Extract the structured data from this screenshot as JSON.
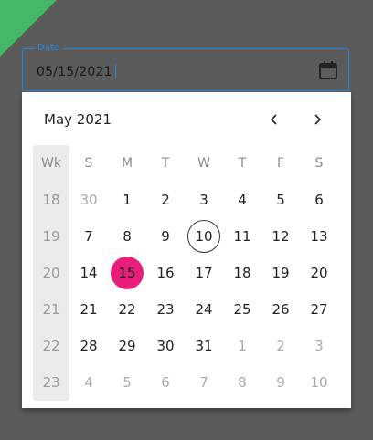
{
  "field": {
    "label": "Date",
    "value": "05/15/2021"
  },
  "calendar": {
    "month_title": "May 2021",
    "prev_symbol": "‹",
    "next_symbol": "›",
    "week_header": "Wk",
    "day_headers": [
      "S",
      "M",
      "T",
      "W",
      "T",
      "F",
      "S"
    ],
    "weeks": [
      {
        "wk": "18",
        "days": [
          {
            "d": "30",
            "muted": true
          },
          {
            "d": "1"
          },
          {
            "d": "2"
          },
          {
            "d": "3"
          },
          {
            "d": "4"
          },
          {
            "d": "5"
          },
          {
            "d": "6"
          }
        ]
      },
      {
        "wk": "19",
        "days": [
          {
            "d": "7"
          },
          {
            "d": "8"
          },
          {
            "d": "9"
          },
          {
            "d": "10",
            "today": true
          },
          {
            "d": "11"
          },
          {
            "d": "12"
          },
          {
            "d": "13"
          }
        ]
      },
      {
        "wk": "20",
        "days": [
          {
            "d": "14"
          },
          {
            "d": "15",
            "selected": true
          },
          {
            "d": "16"
          },
          {
            "d": "17"
          },
          {
            "d": "18"
          },
          {
            "d": "19"
          },
          {
            "d": "20"
          }
        ]
      },
      {
        "wk": "21",
        "days": [
          {
            "d": "21"
          },
          {
            "d": "22"
          },
          {
            "d": "23"
          },
          {
            "d": "24"
          },
          {
            "d": "25"
          },
          {
            "d": "26"
          },
          {
            "d": "27"
          }
        ]
      },
      {
        "wk": "22",
        "days": [
          {
            "d": "28"
          },
          {
            "d": "29"
          },
          {
            "d": "30"
          },
          {
            "d": "31"
          },
          {
            "d": "1",
            "muted": true
          },
          {
            "d": "2",
            "muted": true
          },
          {
            "d": "3",
            "muted": true
          }
        ]
      },
      {
        "wk": "23",
        "days": [
          {
            "d": "4",
            "muted": true
          },
          {
            "d": "5",
            "muted": true
          },
          {
            "d": "6",
            "muted": true
          },
          {
            "d": "7",
            "muted": true
          },
          {
            "d": "8",
            "muted": true
          },
          {
            "d": "9",
            "muted": true
          },
          {
            "d": "10",
            "muted": true
          }
        ]
      }
    ]
  },
  "colors": {
    "accent": "#1e88e5",
    "selected": "#e91e7a",
    "corner": "#44b865",
    "background": "#5b5b5b"
  },
  "icons": {
    "calendar": "calendar-icon"
  }
}
